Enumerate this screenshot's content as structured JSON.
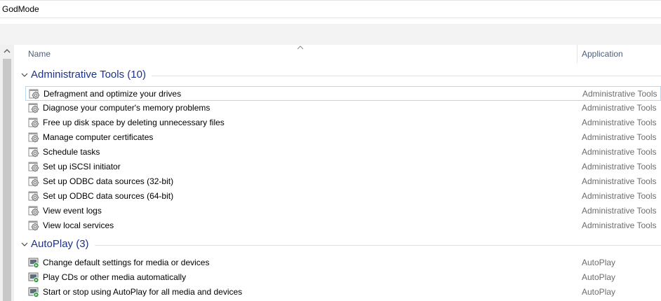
{
  "window": {
    "title": "GodMode"
  },
  "columns": {
    "name": "Name",
    "application": "Application"
  },
  "groups": [
    {
      "title": "Administrative Tools (10)",
      "items": [
        {
          "label": "Defragment and optimize your drives",
          "app": "Administrative Tools",
          "icon": "admin-tools-icon",
          "selected": true
        },
        {
          "label": "Diagnose your computer's memory problems",
          "app": "Administrative Tools",
          "icon": "admin-tools-icon"
        },
        {
          "label": "Free up disk space by deleting unnecessary files",
          "app": "Administrative Tools",
          "icon": "admin-tools-icon"
        },
        {
          "label": "Manage computer certificates",
          "app": "Administrative Tools",
          "icon": "admin-tools-icon"
        },
        {
          "label": "Schedule tasks",
          "app": "Administrative Tools",
          "icon": "admin-tools-icon"
        },
        {
          "label": "Set up iSCSI initiator",
          "app": "Administrative Tools",
          "icon": "admin-tools-icon"
        },
        {
          "label": "Set up ODBC data sources (32-bit)",
          "app": "Administrative Tools",
          "icon": "admin-tools-icon"
        },
        {
          "label": "Set up ODBC data sources (64-bit)",
          "app": "Administrative Tools",
          "icon": "admin-tools-icon"
        },
        {
          "label": "View event logs",
          "app": "Administrative Tools",
          "icon": "admin-tools-icon"
        },
        {
          "label": "View local services",
          "app": "Administrative Tools",
          "icon": "admin-tools-icon"
        }
      ]
    },
    {
      "title": "AutoPlay (3)",
      "items": [
        {
          "label": "Change default settings for media or devices",
          "app": "AutoPlay",
          "icon": "autoplay-icon"
        },
        {
          "label": "Play CDs or other media automatically",
          "app": "AutoPlay",
          "icon": "autoplay-icon"
        },
        {
          "label": "Start or stop using AutoPlay for all media and devices",
          "app": "AutoPlay",
          "icon": "autoplay-icon"
        }
      ]
    }
  ],
  "colors": {
    "group_title": "#1e3287",
    "column_header": "#4c607a",
    "selection_border": "#b7d8f2",
    "app_text": "#6d6d6d"
  }
}
